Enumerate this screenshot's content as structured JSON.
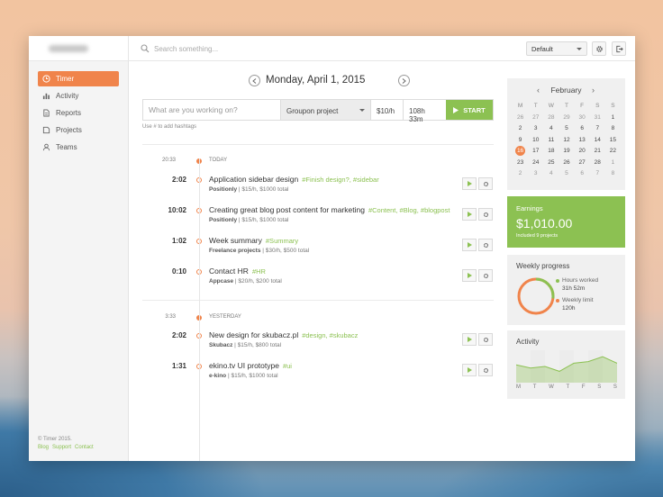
{
  "topbar": {
    "search_placeholder": "Search something...",
    "select_value": "Default",
    "icons": [
      "search-icon",
      "gear-icon",
      "logout-icon"
    ]
  },
  "sidebar": {
    "items": [
      {
        "label": "Timer",
        "icon": "clock-icon",
        "active": true
      },
      {
        "label": "Activity",
        "icon": "bar-chart-icon",
        "active": false
      },
      {
        "label": "Reports",
        "icon": "document-icon",
        "active": false
      },
      {
        "label": "Projects",
        "icon": "folder-icon",
        "active": false
      },
      {
        "label": "Teams",
        "icon": "user-icon",
        "active": false
      }
    ],
    "footer": {
      "copyright": "© Timer 2015.",
      "links": [
        "Blog",
        "Support",
        "Contact"
      ]
    }
  },
  "main": {
    "date": "Monday, April 1, 2015",
    "entry": {
      "placeholder": "What are you working on?",
      "project": "Groupon project",
      "rate": "$10/h",
      "hours": "108h 33m",
      "start_label": "START"
    },
    "hint": "Use # to add hashtags",
    "days": [
      {
        "time": "20:33",
        "label": "TODAY",
        "entries": [
          {
            "duration": "2:02",
            "title": "Application sidebar design",
            "tags": "#Finish design?, #sidebar",
            "project": "Positionly",
            "meta": "$15/h, $1000 total"
          },
          {
            "duration": "10:02",
            "title": "Creating great blog post content for marketing",
            "tags": "#Content, #Blog, #blogpost",
            "project": "Positionly",
            "meta": "$15/h, $1000 total"
          },
          {
            "duration": "1:02",
            "title": "Week summary",
            "tags": "#Summary",
            "project": "Freelance projects",
            "meta": "$30/h, $500 total"
          },
          {
            "duration": "0:10",
            "title": "Contact HR",
            "tags": "#HR",
            "project": "Appcase",
            "meta": "$20/h, $200 total"
          }
        ]
      },
      {
        "time": "3:33",
        "label": "YESTERDAY",
        "entries": [
          {
            "duration": "2:02",
            "title": "New design for skubacz.pl",
            "tags": "#design, #skubacz",
            "project": "Skubacz",
            "meta": "$15/h, $800 total"
          },
          {
            "duration": "1:31",
            "title": "ekino.tv UI prototype",
            "tags": "#ui",
            "project": "e-kino",
            "meta": "$15/h, $1000 total"
          }
        ]
      }
    ]
  },
  "calendar": {
    "month": "February",
    "dow": [
      "M",
      "T",
      "W",
      "T",
      "F",
      "S",
      "S"
    ],
    "weeks": [
      [
        "26",
        "27",
        "28",
        "29",
        "30",
        "31",
        "1"
      ],
      [
        "2",
        "3",
        "4",
        "5",
        "6",
        "7",
        "8"
      ],
      [
        "9",
        "10",
        "11",
        "12",
        "13",
        "14",
        "15"
      ],
      [
        "16",
        "17",
        "18",
        "19",
        "20",
        "21",
        "22"
      ],
      [
        "23",
        "24",
        "25",
        "26",
        "27",
        "28",
        "1"
      ],
      [
        "2",
        "3",
        "4",
        "5",
        "6",
        "7",
        "8"
      ]
    ],
    "today": "16"
  },
  "earnings": {
    "label": "Earnings",
    "amount": "$1,010.00",
    "sub": "Included 9 projects"
  },
  "progress": {
    "label": "Weekly progress",
    "hours_worked_label": "Hours worked",
    "hours_worked": "31h 52m",
    "weekly_limit_label": "Weekly limit",
    "weekly_limit": "120h",
    "fraction": 0.27
  },
  "activity": {
    "label": "Activity",
    "days": [
      "M",
      "T",
      "W",
      "T",
      "F",
      "S",
      "S"
    ],
    "values": [
      0.55,
      0.45,
      0.5,
      0.35,
      0.6,
      0.65,
      0.8,
      0.6
    ]
  },
  "colors": {
    "accent": "#f0844b",
    "green": "#8cc152"
  }
}
